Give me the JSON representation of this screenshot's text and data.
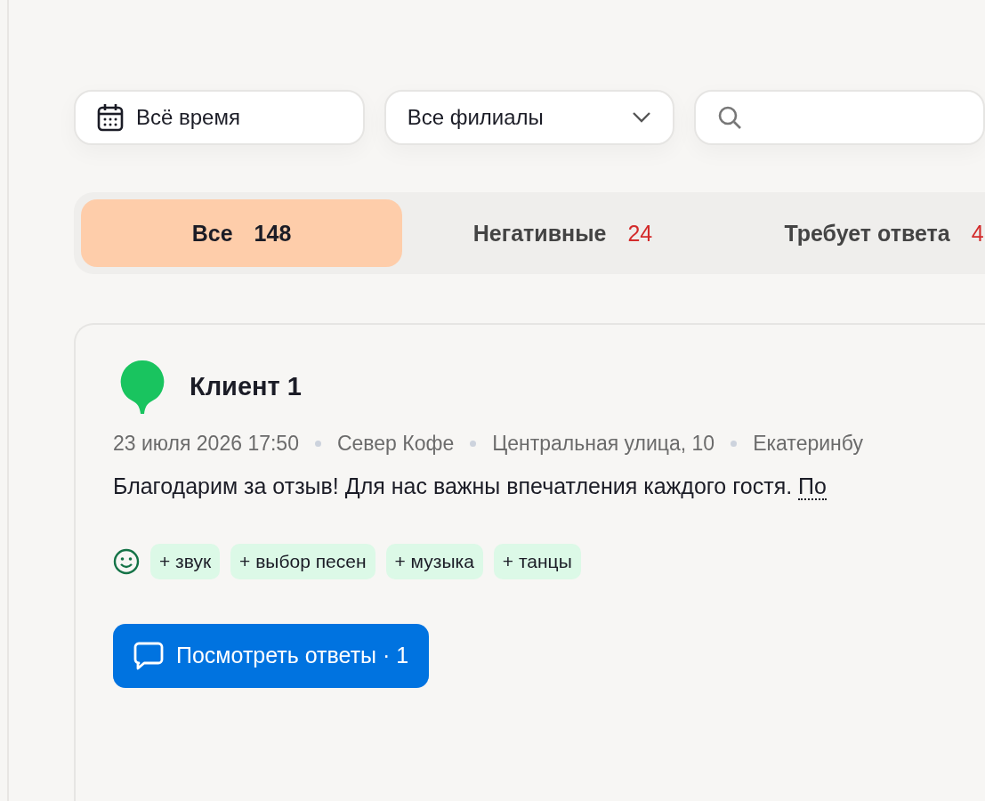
{
  "filters": {
    "period": {
      "value": "Всё время"
    },
    "branch": {
      "value": "Все филиалы"
    }
  },
  "tabs": [
    {
      "label": "Все",
      "count": "148",
      "selected": true
    },
    {
      "label": "Негативные",
      "count": "24",
      "selected": false
    },
    {
      "label": "Требует ответа",
      "count": "4",
      "selected": false
    }
  ],
  "review": {
    "author": "Клиент 1",
    "meta": [
      "23 июля 2026 17:50",
      "Север Кофе",
      "Центральная улица, 10",
      "Екатеринбу"
    ],
    "text": "Благодарим за отзыв! Для нас важны впечатления каждого гостя.",
    "link": "По",
    "positive": true,
    "tags": [
      "+ звук",
      "+ выбор песен",
      "+ музыка",
      "+ танцы"
    ],
    "button": "Посмотреть ответы · 1"
  }
}
